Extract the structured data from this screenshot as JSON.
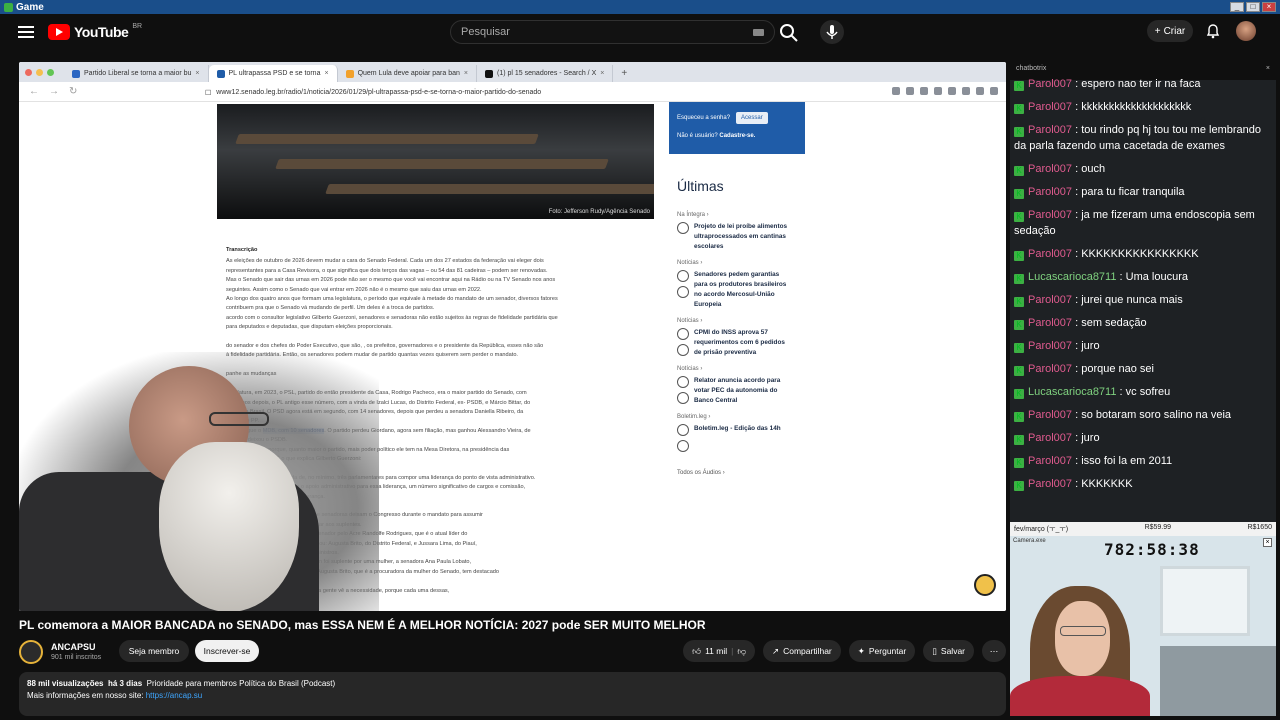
{
  "window": {
    "title": "Game"
  },
  "yt": {
    "logo_text": "YouTube",
    "region": "BR",
    "search_placeholder": "Pesquisar",
    "create_label": "Criar"
  },
  "browser": {
    "tabs": [
      {
        "label": "Partido Liberal se torna a maior bu",
        "color": "#2b66c2"
      },
      {
        "label": "PL ultrapassa PSD e se torna",
        "color": "#1f5ca8"
      },
      {
        "label": "Quem Lula deve apoiar para ban",
        "color": "#f2a12b"
      },
      {
        "label": "(1) pl 15 senadores - Search / X",
        "color": "#111111"
      }
    ],
    "url": "www12.senado.leg.br/radio/1/noticia/2026/01/29/pl-ultrapassa-psd-e-se-torna-o-maior-partido-do-senado"
  },
  "page": {
    "photo_credit": "Foto: Jefferson Rudy/Agência Senado",
    "transcript_label": "Transcrição",
    "transcript_lines": [
      "As eleições de outubro de 2026 devem mudar a cara do Senado Federal. Cada um dos 27 estados da federação vai eleger dois",
      "representantes para a Casa Revisora, o que significa que dois terços das vagas – ou 54 das 81 cadeiras – podem ser renovadas.",
      "Mas o Senado que sair das urnas em 2026 pode não ser o mesmo que você vai encontrar aqui na Rádio ou na TV Senado nos anos",
      "seguintes. Assim como o Senado que vai entrar em 2026 não é o mesmo que saiu das urnas em 2022.",
      "Ao longo dos quatro anos que formam uma legislatura, o período que equivale à metade do mandato de um senador, diversos fatores",
      "contribuem pra que o Senado vá mudando de perfil. Um deles é a troca de partidos.",
      "acordo com o consultor legislativo Gilberto Guerzoni, senadores e senadoras não estão sujeitos às regras de fidelidade partidária que",
      "para deputados e deputadas, que disputam eleições proporcionais.",
      "",
      "do senador e dos chefes do Poder Executivo, que são, , os prefeitos, governadores e o presidente da República, esses não são",
      "à fidelidade partidária. Então, os senadores podem mudar de partido quantas vezes quiserem sem perder o mandato.",
      "",
      "panhe as mudanças",
      "",
      "legislatura, em 2023, o PSL, partido do então presidente da Casa, Rodrigo Pacheco, era o maior partido do Senado, com",
      "Três anos depois, o PL antigo esse número, com a vinda de Izalci Lucas, do Distrito Federal, ex- PSDB, e Márcio Bittar, do",
      "do União Brasil. O PSD agora está em segundo, com 14 senadores, depois que perdeu a senadora Daniella Ribeiro, da",
      "foi para o PP.",
      "lugar, segue o |MDB, com 10 senadores|. O partido perdeu Giordano, agora sem filiação, mas ganhou Alessandro Vieira, de",
      "também deixou o PSDB.",
      "mais não é. Isso porque, quanto maior o partido, mais poder político ele tem na Mesa Diretora, na presidência das",
      "Colégio de Líderes. É o que explica Gilberto Guerzoni:",
      "",
      "cê tem que ter uma bancada de, no mínimo, três parlamentares para compor uma liderança do ponto de vista administrativo.",
      "uma liderança, você tem todo o apoio administrativo para essa liderança, um número significativo de cargos e comissão,",
      "ativa para isso, o gabinete de liderança.",
      "",
      "troca de partidos. Alguns senadores e senadoras deixam o Congresso durante o mandato para assumir",
      "ndidatar a cargos públicos, dando lugar aos suplentes.",
      "ng, com 9 cadeiras – incluindo a do senador pelo Acre Randolfe Rodrigues, que é o atual líder do",
      "representação do PT no Senado mudou: Augusta Brito, do Distrito Federal, e Jussara Lima, do Piauí,",
      "e Wellington Dias, que se tornaram ministros.",
      "eleito pelo PSB do Maranhão, também foi suplente por uma mulher, a senadora Ana Paula Lobato,",
      "ração ao PDT, em 2025. A senadora Augusta Brito, que é a procuradora da mulher do Senado, tem destacado",
      "",
      "mulheres aqui no Senado Federal, e a gente vê a necessidade, porque cada uma dessas,"
    ],
    "login": {
      "forgot": "Esqueceu a senha?",
      "enter": "Acessar",
      "not_user": "Não é usuário?",
      "register": "Cadastre-se."
    },
    "ultimas_title": "Últimas",
    "news": [
      {
        "category": "Na Íntegra ›",
        "title": "Projeto de lei proíbe alimentos ultraprocessados em cantinas escolares",
        "icons": 1
      },
      {
        "category": "Notícias ›",
        "title": "Senadores pedem garantias para os produtores brasileiros no acordo Mercosul-União Europeia",
        "icons": 2
      },
      {
        "category": "Notícias ›",
        "title": "CPMI do INSS aprova 57 requerimentos com 6 pedidos de prisão preventiva",
        "icons": 2
      },
      {
        "category": "Notícias ›",
        "title": "Relator anuncia acordo para votar PEC da autonomia do Banco Central",
        "icons": 2
      },
      {
        "category": "Boletim.leg ›",
        "title": "Boletim.leg - Edição das 14h",
        "icons": 2
      }
    ],
    "all_audio": "Todos os Áudios ›"
  },
  "video": {
    "title": "PL comemora a MAIOR BANCADA no SENADO, mas ESSA NEM É A MELHOR NOTÍCIA: 2027 pode SER MUITO MELHOR",
    "channel": "ANCAPSU",
    "subscribers": "901 mil inscritos",
    "member_label": "Seja membro",
    "subscribe_label": "Inscrever-se",
    "likes": "11 mil",
    "share_label": "Compartilhar",
    "ask_label": "Perguntar",
    "save_label": "Salvar",
    "views": "88 mil visualizações",
    "age": "há 3 dias",
    "tags": "Prioridade para membros  Política do Brasil (Podcast)",
    "more_info": "Mais informações em nosso site:",
    "site_link": "https://ancap.su"
  },
  "chat": {
    "title": "chatbotrix",
    "messages": [
      {
        "user": "Parol007",
        "text": "espero nao ter ir na faca",
        "c": "u1"
      },
      {
        "user": "Parol007",
        "text": "kkkkkkkkkkkkkkkkkkkk",
        "c": "u1"
      },
      {
        "user": "Parol007",
        "text": "tou rindo pq hj tou tou me lembrando da parla fazendo uma cacetada de exames",
        "c": "u1"
      },
      {
        "user": "Parol007",
        "text": "ouch",
        "c": "u1"
      },
      {
        "user": "Parol007",
        "text": "para tu ficar tranquila",
        "c": "u1"
      },
      {
        "user": "Parol007",
        "text": "ja me fizeram uma endoscopia sem sedação",
        "c": "u1"
      },
      {
        "user": "Parol007",
        "text": "KKKKKKKKKKKKKKKK",
        "c": "u1"
      },
      {
        "user": "Lucascarioca8711",
        "text": "Uma loucura",
        "c": "u2"
      },
      {
        "user": "Parol007",
        "text": "jurei que nunca mais",
        "c": "u1"
      },
      {
        "user": "Parol007",
        "text": "sem sedação",
        "c": "u1"
      },
      {
        "user": "Parol007",
        "text": "juro",
        "c": "u1"
      },
      {
        "user": "Parol007",
        "text": "porque nao sei",
        "c": "u1"
      },
      {
        "user": "Lucascarioca8711",
        "text": "vc sofreu",
        "c": "u2"
      },
      {
        "user": "Parol007",
        "text": "so botaram soro salino na veia",
        "c": "u1"
      },
      {
        "user": "Parol007",
        "text": "juro",
        "c": "u1"
      },
      {
        "user": "Parol007",
        "text": "isso foi la em 2011",
        "c": "u1"
      },
      {
        "user": "Parol007",
        "text": "KKKKKKK",
        "c": "u1"
      }
    ]
  },
  "stream": {
    "goal_left": "fev/março (ㅜ_ㅜ)",
    "goal_mid": "R$59.99",
    "goal_right": "R$1650",
    "webcam_title": "Camera.exe",
    "clock": "782:58:38"
  },
  "colors": {
    "yt_bg": "#0f0f0f",
    "senado_blue": "#1f5ca8",
    "chat_user": "#e05b8f",
    "chat_user2": "#7fd17f"
  }
}
